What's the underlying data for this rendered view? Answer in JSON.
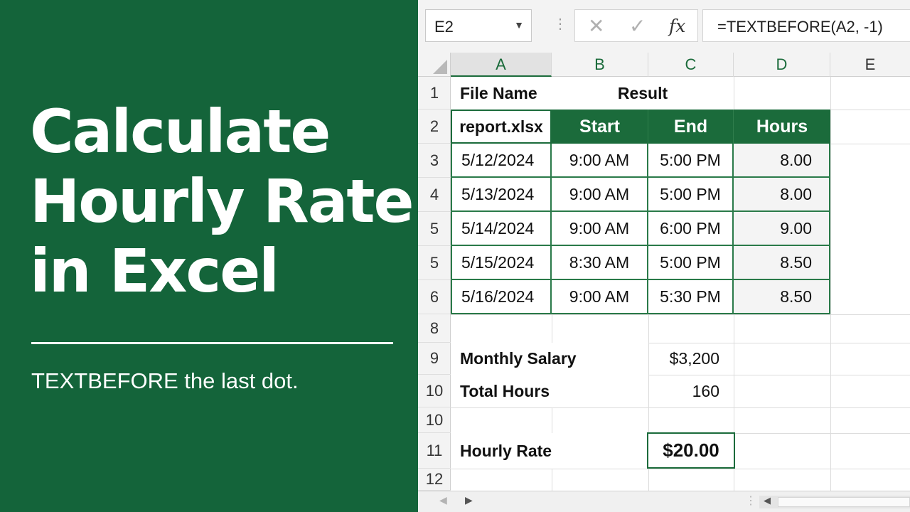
{
  "promo": {
    "title_lines": [
      "Calculate",
      "Hourly Rate",
      "in Excel"
    ],
    "subtitle": "TEXTBEFORE the last dot."
  },
  "formula_bar": {
    "name_box": "E2",
    "cancel_symbol": "✕",
    "enter_symbol": "✓",
    "fx_label": "fx",
    "formula": "=TEXTBEFORE(A2, -1)"
  },
  "columns": [
    "A",
    "B",
    "C",
    "D",
    "E"
  ],
  "rows": [
    "1",
    "2",
    "3",
    "4",
    "5",
    "5",
    "6",
    "8",
    "9",
    "10",
    "10",
    "11",
    "12"
  ],
  "cells": {
    "a1": "File Name",
    "b1": "Result",
    "a2": "report.xlsx",
    "b2": "Start",
    "c2": "End",
    "d2": "Hours",
    "data": [
      {
        "date": "5/12/2024",
        "start": "9:00 AM",
        "end": "5:00 PM",
        "hours": "8.00"
      },
      {
        "date": "5/13/2024",
        "start": "9:00 AM",
        "end": "5:00 PM",
        "hours": "8.00"
      },
      {
        "date": "5/14/2024",
        "start": "9:00 AM",
        "end": "6:00 PM",
        "hours": "9.00"
      },
      {
        "date": "5/15/2024",
        "start": "8:30 AM",
        "end": "5:00 PM",
        "hours": "8.50"
      },
      {
        "date": "5/16/2024",
        "start": "9:00 AM",
        "end": "5:30 PM",
        "hours": "8.50"
      }
    ],
    "monthly_salary_label": "Monthly Salary",
    "monthly_salary_value": "$3,200",
    "total_hours_label": "Total Hours",
    "total_hours_value": "160",
    "hourly_rate_label": "Hourly Rate",
    "hourly_rate_value": "$20.00"
  },
  "colors": {
    "excel_green": "#14643a",
    "header_green": "#1b6b3b"
  }
}
